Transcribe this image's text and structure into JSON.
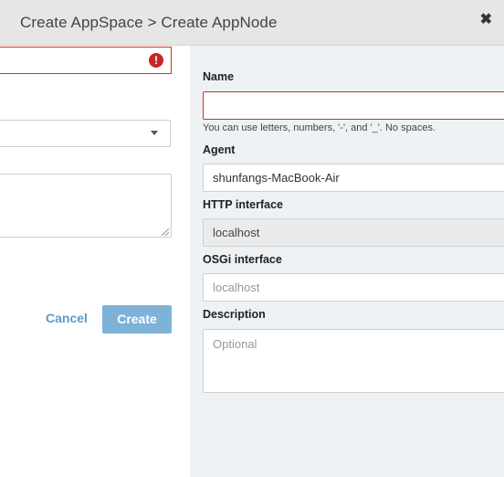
{
  "dialog": {
    "title": "Create AppSpace > Create AppNode",
    "close_glyph": "✖"
  },
  "left_form": {
    "error_glyph": "!",
    "cancel_label": "Cancel",
    "create_label": "Create"
  },
  "right_form": {
    "name": {
      "label": "Name",
      "value": "",
      "help": "You can use letters, numbers, '-', and '_'. No spaces."
    },
    "agent": {
      "label": "Agent",
      "value": "shunfangs-MacBook-Air"
    },
    "http": {
      "label": "HTTP interface",
      "value": "localhost"
    },
    "osgi": {
      "label": "OSGi interface",
      "placeholder": "localhost"
    },
    "description": {
      "label": "Description",
      "placeholder": "Optional"
    }
  },
  "colors": {
    "accent": "#7fb2d8",
    "error": "#c62828",
    "link": "#5b9bc9"
  }
}
